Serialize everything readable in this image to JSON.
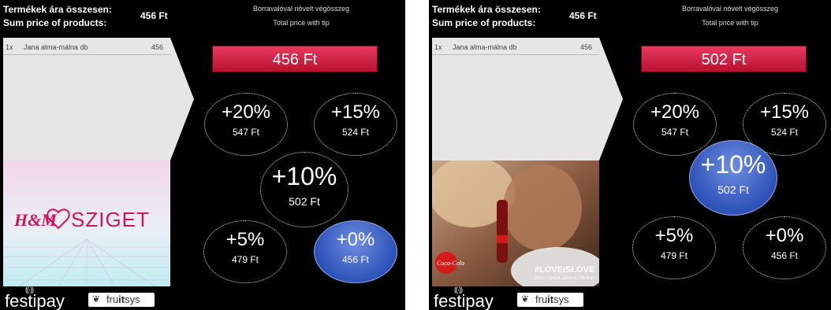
{
  "screens": [
    {
      "header": {
        "label_hu": "Termékek ára összesen:",
        "label_en": "Sum price of products:",
        "amount": "456 Ft"
      },
      "cart_items": [
        {
          "qty": "1x",
          "name": "Jana alma-málna db",
          "price": "456"
        }
      ],
      "tip": {
        "title_hu": "Borravalóval növelt végösszeg",
        "title_en": "Total price with tip",
        "total": "456 Ft"
      },
      "options": [
        {
          "pct": "+20%",
          "amount": "547 Ft"
        },
        {
          "pct": "+15%",
          "amount": "524 Ft"
        },
        {
          "pct": "+10%",
          "amount": "502 Ft"
        },
        {
          "pct": "+5%",
          "amount": "479 Ft"
        },
        {
          "pct": "+0%",
          "amount": "456 Ft"
        }
      ],
      "selected_option": "+0%",
      "ad": {
        "logo_text": "SZIGET",
        "brand_text": "H&M"
      },
      "footer": {
        "festipay": "festipay",
        "fruitsys_a": "fru",
        "fruitsys_b": "it",
        "fruitsys_c": "sys"
      }
    },
    {
      "header": {
        "label_hu": "Termékek ára összesen:",
        "label_en": "Sum price of products:",
        "amount": "456 Ft"
      },
      "cart_items": [
        {
          "qty": "1x",
          "name": "Jana alma-málna db",
          "price": "456"
        }
      ],
      "tip": {
        "title_hu": "Borravalóval növelt végösszeg",
        "title_en": "Total price with tip",
        "total": "502 Ft"
      },
      "options": [
        {
          "pct": "+20%",
          "amount": "547 Ft"
        },
        {
          "pct": "+15%",
          "amount": "524 Ft"
        },
        {
          "pct": "+10%",
          "amount": "502 Ft"
        },
        {
          "pct": "+5%",
          "amount": "479 Ft"
        },
        {
          "pct": "+0%",
          "amount": "456 Ft"
        }
      ],
      "selected_option": "+10%",
      "ad": {
        "hashtag": "#LOVEISLOVE",
        "subline": "ZERO CUKOR ZERO KLÓRFILET",
        "brand": "Coca-Cola"
      },
      "footer": {
        "festipay": "festipay",
        "fruitsys_a": "fru",
        "fruitsys_b": "it",
        "fruitsys_c": "sys"
      }
    }
  ],
  "colors": {
    "total_bar": "#d6244a",
    "selected_circle": "#2c52b8",
    "background": "#000000"
  }
}
